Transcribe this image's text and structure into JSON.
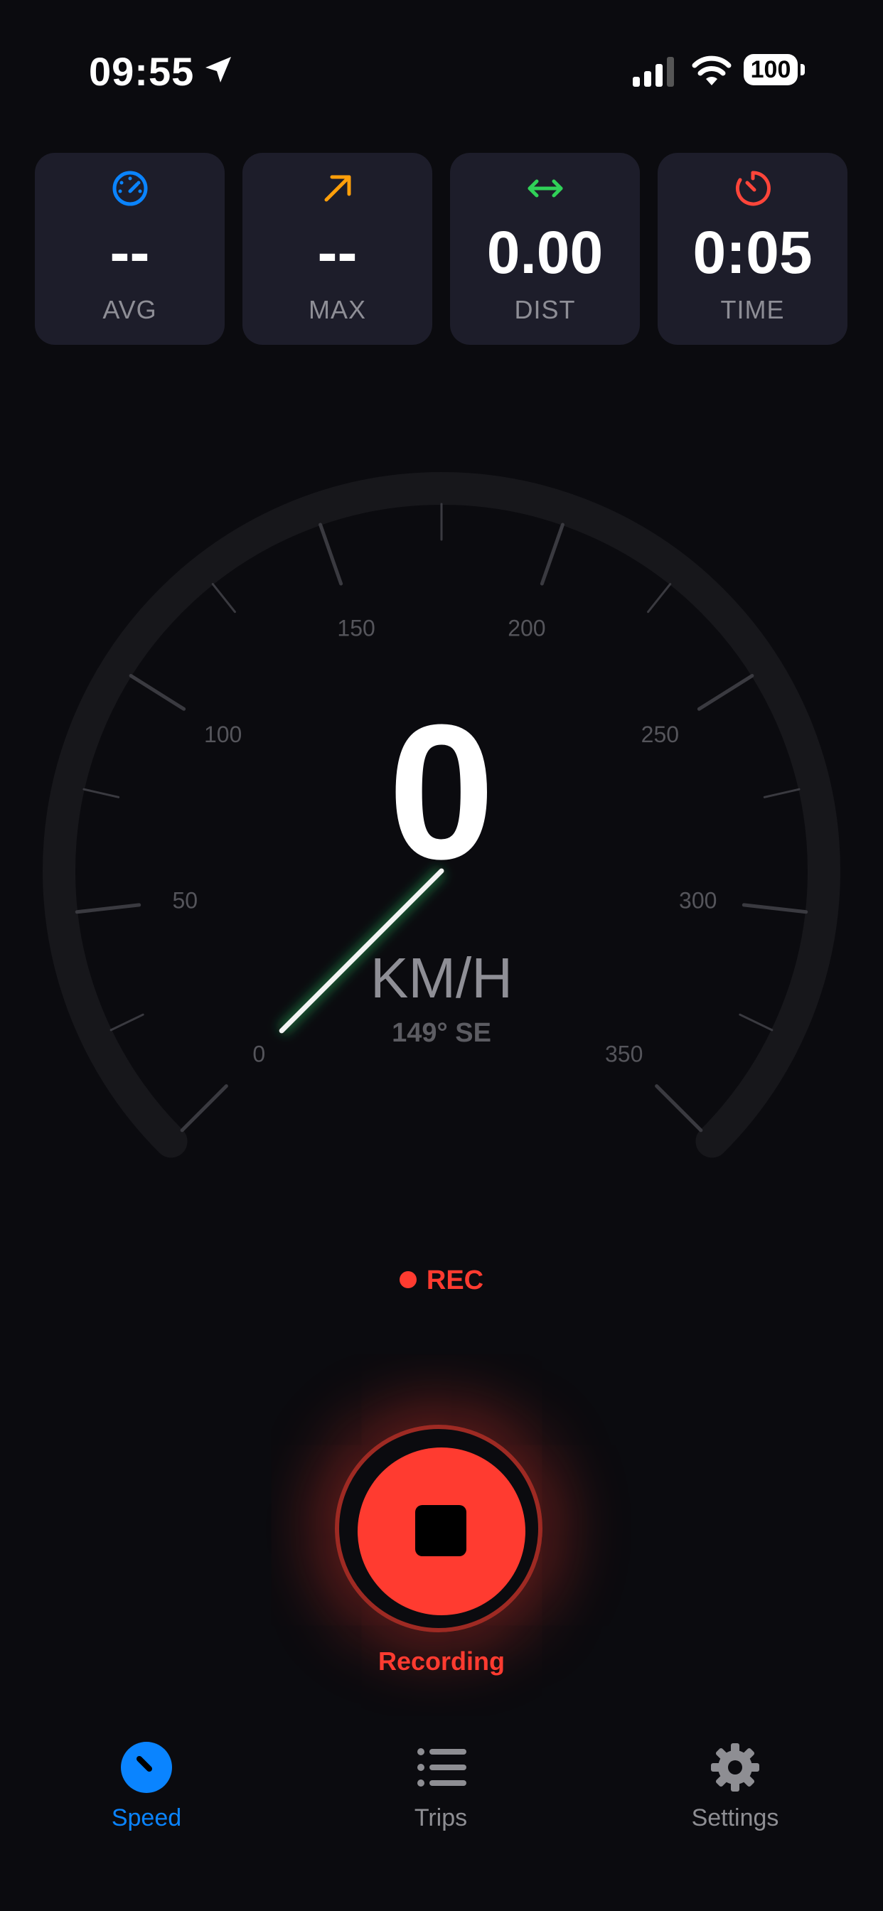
{
  "status_bar": {
    "time": "09:55",
    "battery": "100"
  },
  "stats": [
    {
      "value": "--",
      "label": "AVG",
      "icon": "speedometer-icon",
      "color": "#0a84ff"
    },
    {
      "value": "--",
      "label": "MAX",
      "icon": "arrow-up-right-icon",
      "color": "#ff9f0a"
    },
    {
      "value": "0.00",
      "label": "DIST",
      "icon": "arrow-left-right-icon",
      "color": "#30d158"
    },
    {
      "value": "0:05",
      "label": "TIME",
      "icon": "timer-icon",
      "color": "#ff453a"
    }
  ],
  "gauge": {
    "speed": "0",
    "unit": "KM/H",
    "heading": "149° SE",
    "scale_labels": [
      "0",
      "50",
      "100",
      "150",
      "200",
      "250",
      "300",
      "350"
    ],
    "scale_min": 0,
    "scale_max": 350,
    "current_speed_value": 0
  },
  "recording": {
    "indicator": "REC",
    "button_caption": "Recording",
    "accent_color": "#ff3b30"
  },
  "tabs": [
    {
      "label": "Speed",
      "icon": "speedometer-icon",
      "active": true
    },
    {
      "label": "Trips",
      "icon": "list-icon",
      "active": false
    },
    {
      "label": "Settings",
      "icon": "gear-icon",
      "active": false
    }
  ],
  "colors": {
    "active_tab": "#0a84ff",
    "inactive_tab": "#8e8e93",
    "background": "#0b0b0f",
    "card": "#1d1d2a"
  }
}
